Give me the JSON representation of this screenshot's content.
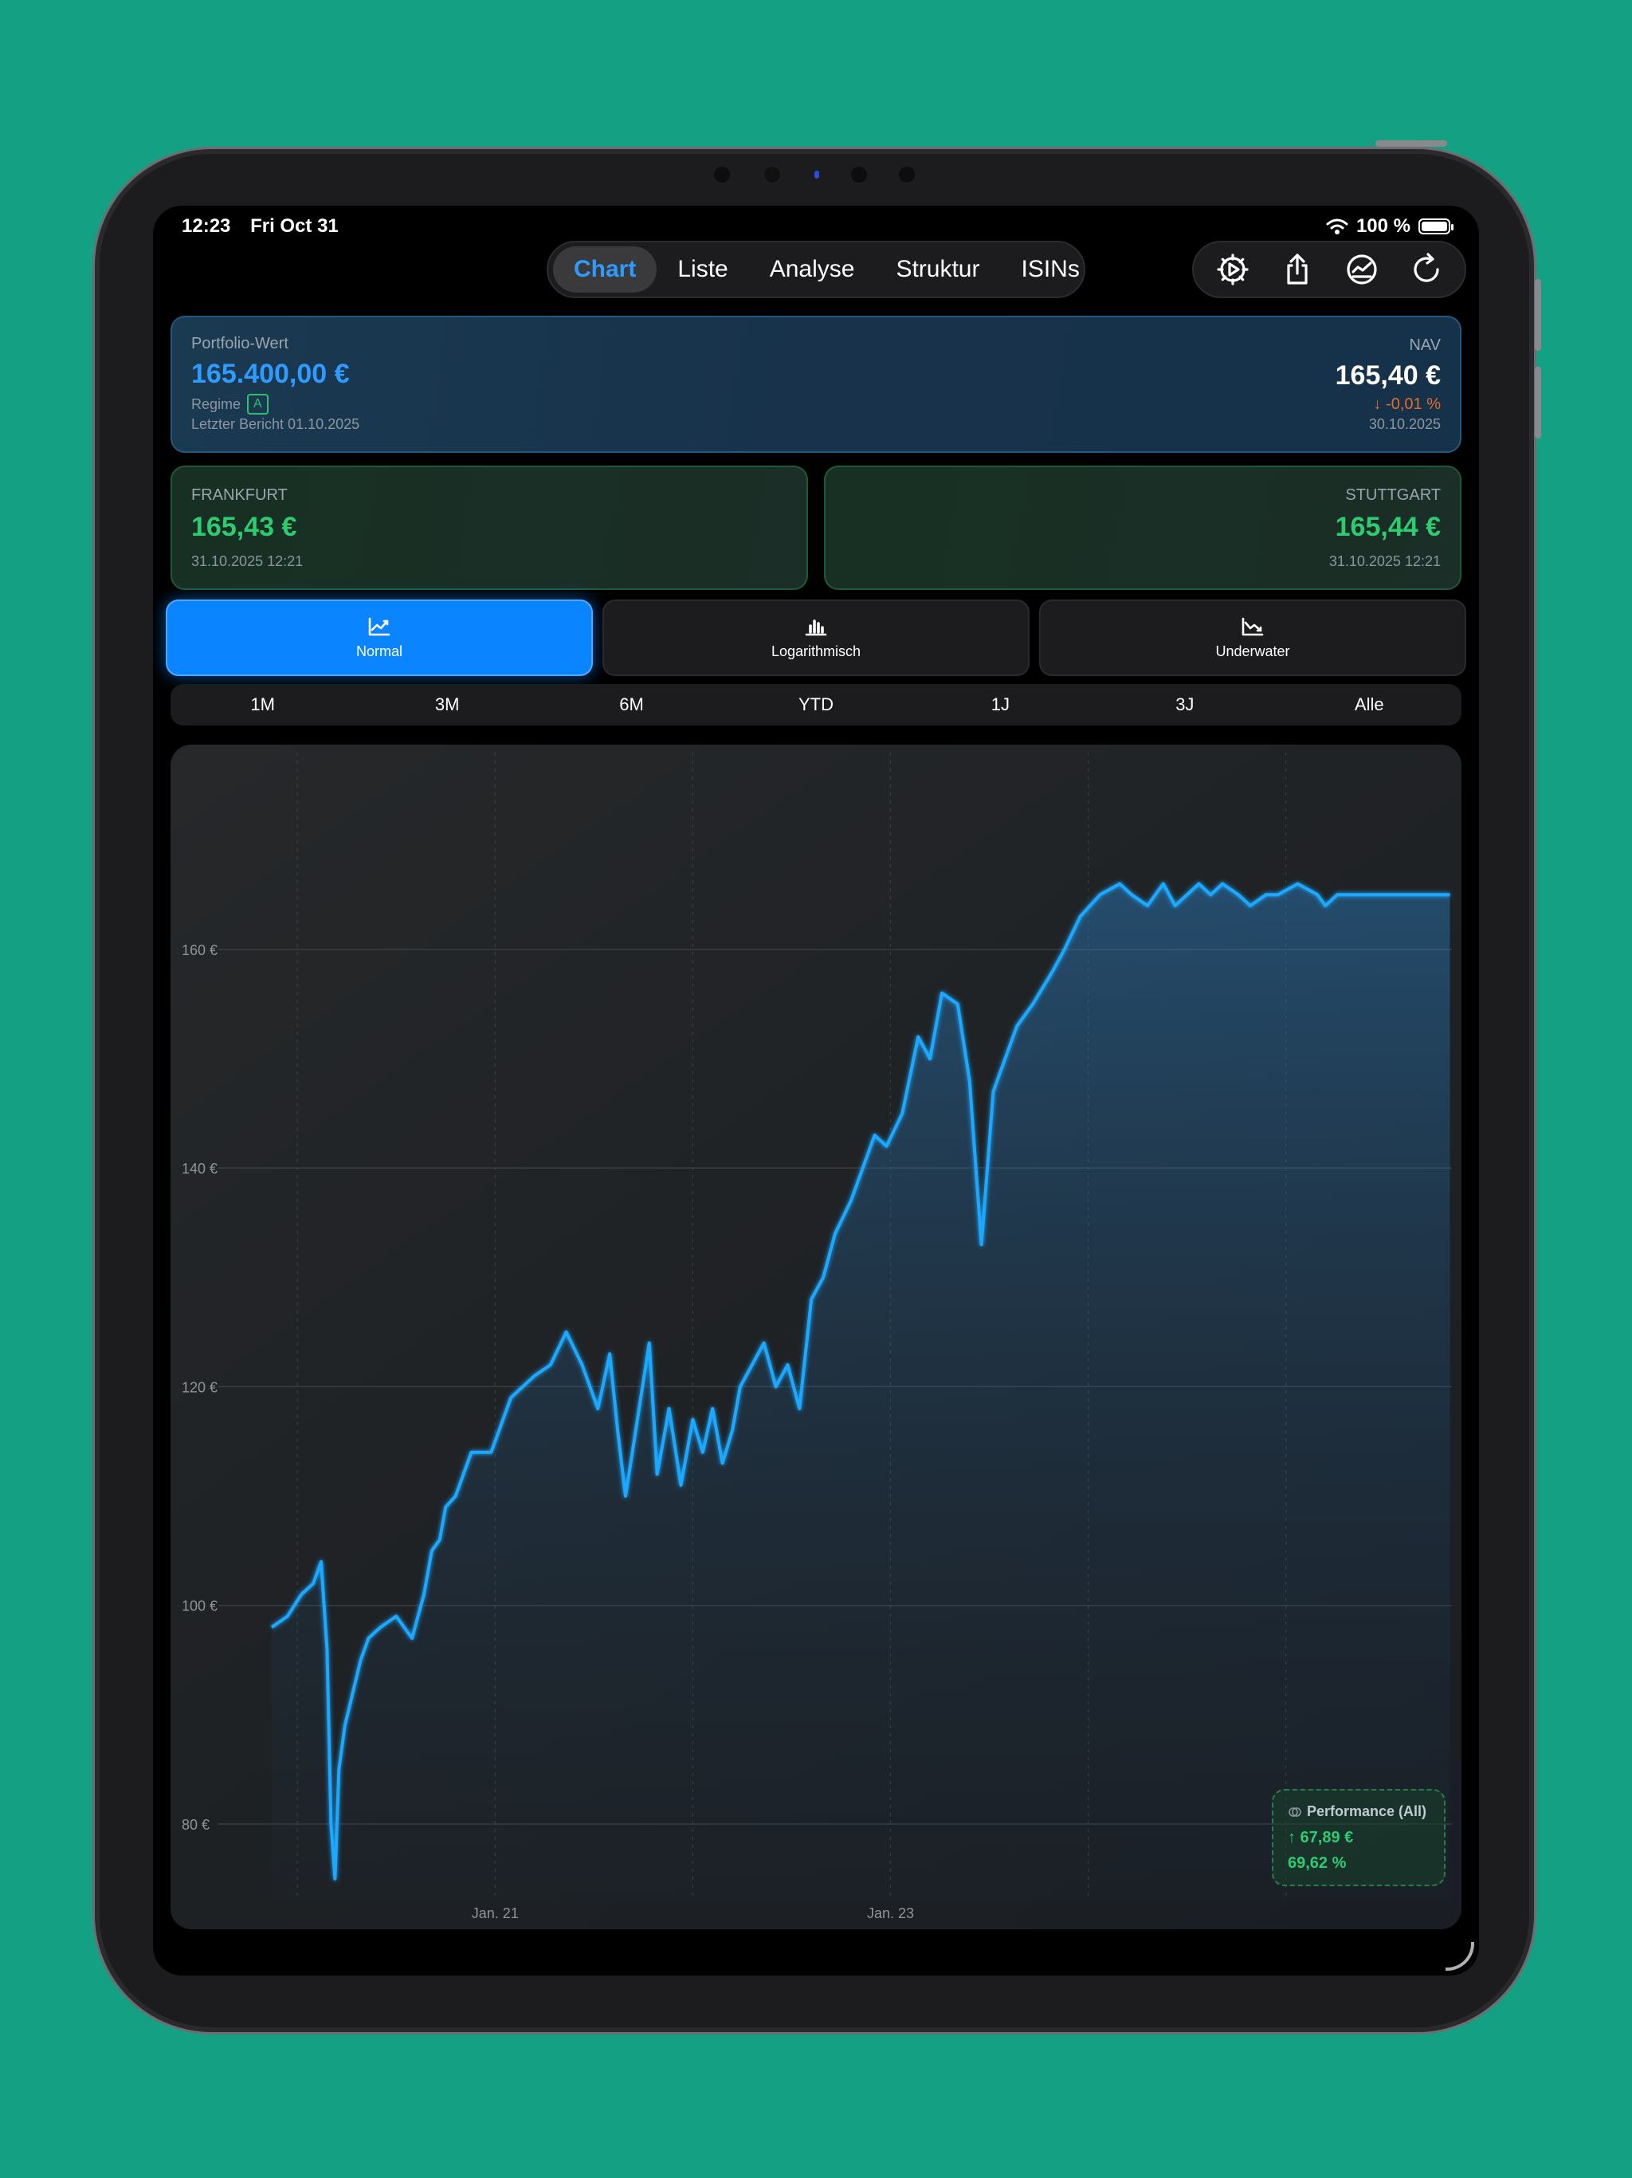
{
  "status": {
    "time": "12:23",
    "date": "Fri Oct 31",
    "battery": "100 %",
    "battery_level": 1.0
  },
  "tabs": [
    {
      "label": "Chart",
      "active": true
    },
    {
      "label": "Liste"
    },
    {
      "label": "Analyse"
    },
    {
      "label": "Struktur"
    },
    {
      "label": "ISINs"
    }
  ],
  "toolbar": {
    "icons": [
      "settings-play-icon",
      "share-icon",
      "performance-chart-icon",
      "refresh-icon"
    ]
  },
  "portfolio": {
    "label": "Portfolio-Wert",
    "value": "165.400,00 €",
    "regime_label": "Regime",
    "regime_badge": "A",
    "report": "Letzter Bericht 01.10.2025",
    "nav_label": "NAV",
    "nav_value": "165,40 €",
    "nav_change": "↓ -0,01 %",
    "nav_date": "30.10.2025"
  },
  "exchanges": {
    "frankfurt": {
      "name": "FRANKFURT",
      "price": "165,43 €",
      "time": "31.10.2025 12:21"
    },
    "stuttgart": {
      "name": "STUTTGART",
      "price": "165,44 €",
      "time": "31.10.2025 12:21"
    }
  },
  "modes": [
    {
      "label": "Normal",
      "icon": "line-chart-icon",
      "active": true
    },
    {
      "label": "Logarithmisch",
      "icon": "bar-chart-icon"
    },
    {
      "label": "Underwater",
      "icon": "drawdown-chart-icon"
    }
  ],
  "ranges": [
    "1M",
    "3M",
    "6M",
    "YTD",
    "1J",
    "3J",
    "Alle"
  ],
  "performance": {
    "title": "Performance (All)",
    "absolute": "↑ 67,89 €",
    "percent": "69,62 %"
  },
  "colors": {
    "accent": "#0a84ff",
    "line": "#1fa8ff",
    "positive": "#2ecc71",
    "negative": "#e56b2c"
  },
  "chart_data": {
    "type": "line",
    "ylim": [
      73,
      178
    ],
    "xlim": [
      2019.6,
      2025.84
    ],
    "y_ticks": [
      80,
      100,
      120,
      140,
      160
    ],
    "y_tick_labels": [
      "80 €",
      "100 €",
      "120 €",
      "140 €",
      "160 €"
    ],
    "x_tick_values": [
      2021.0,
      2023.0
    ],
    "x_tick_labels": [
      "Jan. 21",
      "Jan. 23"
    ],
    "grid": true,
    "series": [
      {
        "x": [
          2019.87,
          2019.95,
          2020.02,
          2020.08,
          2020.12,
          2020.15,
          2020.17,
          2020.19,
          2020.21,
          2020.24,
          2020.28,
          2020.32,
          2020.36,
          2020.42,
          2020.5,
          2020.58,
          2020.64,
          2020.68,
          2020.72,
          2020.75,
          2020.8,
          2020.88,
          2020.98,
          2021.08,
          2021.14,
          2021.2,
          2021.28,
          2021.36,
          2021.44,
          2021.52,
          2021.58,
          2021.62,
          2021.66,
          2021.72,
          2021.78,
          2021.82,
          2021.88,
          2021.94,
          2022.0,
          2022.05,
          2022.1,
          2022.15,
          2022.2,
          2022.24,
          2022.3,
          2022.36,
          2022.42,
          2022.48,
          2022.54,
          2022.6,
          2022.66,
          2022.72,
          2022.8,
          2022.86,
          2022.92,
          2022.98,
          2023.06,
          2023.14,
          2023.2,
          2023.26,
          2023.34,
          2023.4,
          2023.46,
          2023.52,
          2023.58,
          2023.64,
          2023.72,
          2023.82,
          2023.88,
          2023.96,
          2024.06,
          2024.16,
          2024.22,
          2024.3,
          2024.38,
          2024.44,
          2024.5,
          2024.56,
          2024.62,
          2024.68,
          2024.76,
          2024.82,
          2024.9,
          2024.96,
          2025.06,
          2025.16,
          2025.2,
          2025.26,
          2025.3,
          2025.34,
          2025.44,
          2025.56,
          2025.68,
          2025.78,
          2025.83
        ],
        "y": [
          98,
          99,
          101,
          102,
          104,
          96,
          80,
          75,
          85,
          89,
          92,
          95,
          97,
          98,
          99,
          97,
          101,
          105,
          106,
          109,
          110,
          114,
          114,
          119,
          120,
          121,
          122,
          125,
          122,
          118,
          123,
          116,
          110,
          117,
          124,
          112,
          118,
          111,
          117,
          114,
          118,
          113,
          116,
          120,
          122,
          124,
          120,
          122,
          118,
          128,
          130,
          134,
          137,
          140,
          143,
          142,
          145,
          152,
          150,
          156,
          155,
          148,
          133,
          147,
          150,
          153,
          155,
          158,
          160,
          163,
          165,
          166,
          165,
          164,
          166,
          164,
          165,
          166,
          165,
          166,
          165,
          164,
          165,
          165,
          166,
          165,
          164,
          165,
          165,
          165,
          165,
          165,
          165,
          165,
          165
        ]
      }
    ]
  }
}
